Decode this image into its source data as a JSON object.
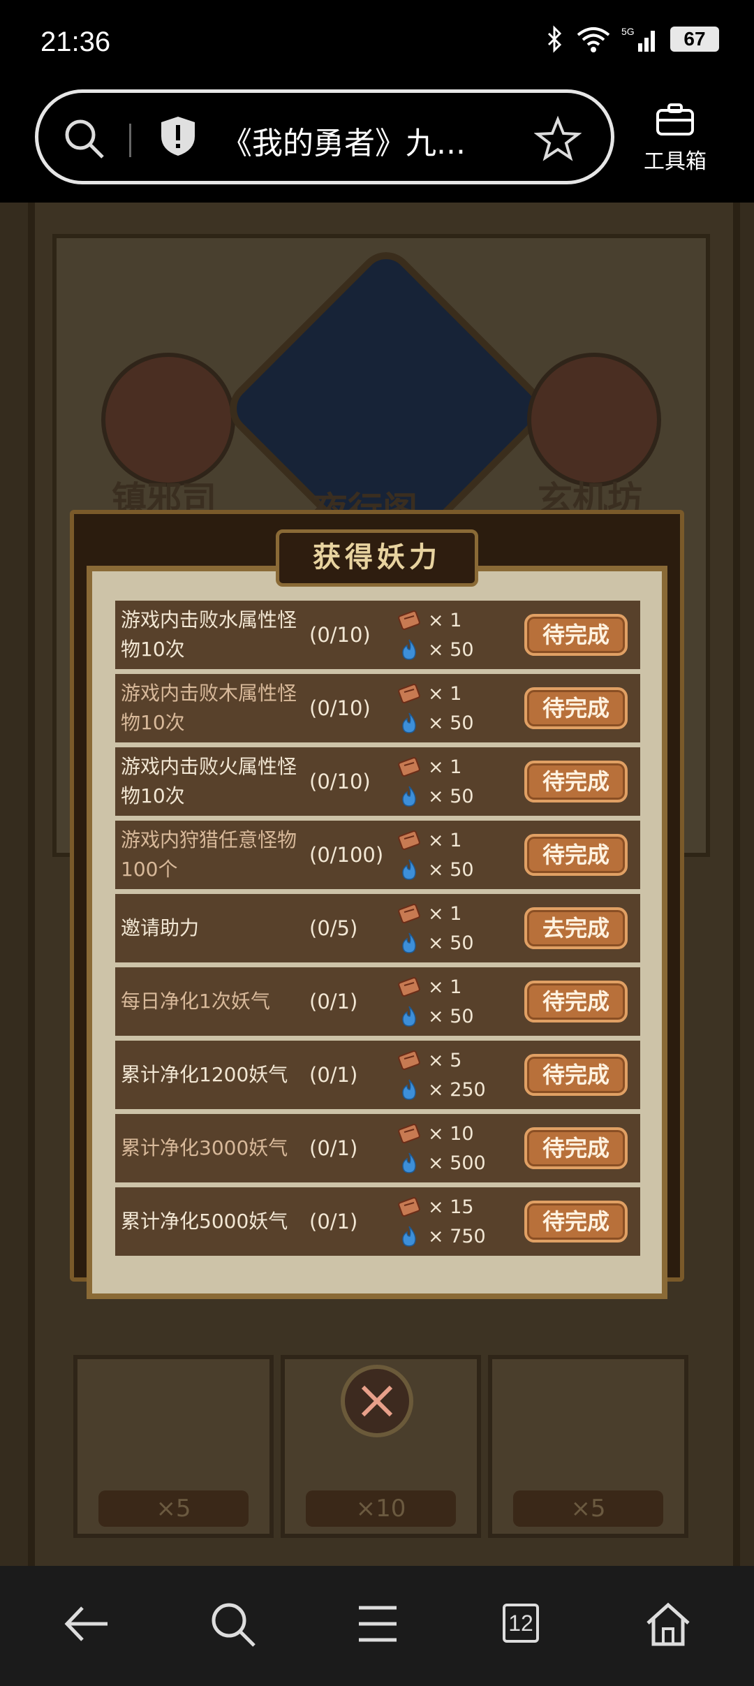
{
  "status_bar": {
    "time": "21:36",
    "network": "5G",
    "battery": "67"
  },
  "browser": {
    "page_title": "《我的勇者》九...",
    "toolbox_label": "工具箱",
    "tab_count": "12"
  },
  "background": {
    "medals": [
      "镇邪司",
      "夜行阁",
      "玄机坊"
    ],
    "cards": [
      {
        "badge": "×5"
      },
      {
        "badge": "×10"
      },
      {
        "badge": "×5"
      }
    ]
  },
  "modal": {
    "title": "获得妖力",
    "tasks": [
      {
        "name": "游戏内击败水属性怪物10次",
        "progress": "(0/10)",
        "reward1": "× 1",
        "reward2": "× 50",
        "button": "待完成",
        "dim": false
      },
      {
        "name": "游戏内击败木属性怪物10次",
        "progress": "(0/10)",
        "reward1": "× 1",
        "reward2": "× 50",
        "button": "待完成",
        "dim": true
      },
      {
        "name": "游戏内击败火属性怪物10次",
        "progress": "(0/10)",
        "reward1": "× 1",
        "reward2": "× 50",
        "button": "待完成",
        "dim": false
      },
      {
        "name": "游戏内狩猎任意怪物100个",
        "progress": "(0/100)",
        "reward1": "× 1",
        "reward2": "× 50",
        "button": "待完成",
        "dim": true
      },
      {
        "name": "邀请助力",
        "progress": "(0/5)",
        "reward1": "× 1",
        "reward2": "× 50",
        "button": "去完成",
        "dim": false
      },
      {
        "name": "每日净化1次妖气",
        "progress": "(0/1)",
        "reward1": "× 1",
        "reward2": "× 50",
        "button": "待完成",
        "dim": true
      },
      {
        "name": "累计净化1200妖气",
        "progress": "(0/1)",
        "reward1": "× 5",
        "reward2": "× 250",
        "button": "待完成",
        "dim": false
      },
      {
        "name": "累计净化3000妖气",
        "progress": "(0/1)",
        "reward1": "× 10",
        "reward2": "× 500",
        "button": "待完成",
        "dim": true
      },
      {
        "name": "累计净化5000妖气",
        "progress": "(0/1)",
        "reward1": "× 15",
        "reward2": "× 750",
        "button": "待完成",
        "dim": false
      }
    ]
  },
  "icons": {
    "reward_scroll": "scroll-icon",
    "reward_flame": "blue-flame-icon"
  },
  "colors": {
    "row_bg": "#58412b",
    "button_bg": "#b8703a",
    "modal_bg": "#cdc3a8"
  }
}
